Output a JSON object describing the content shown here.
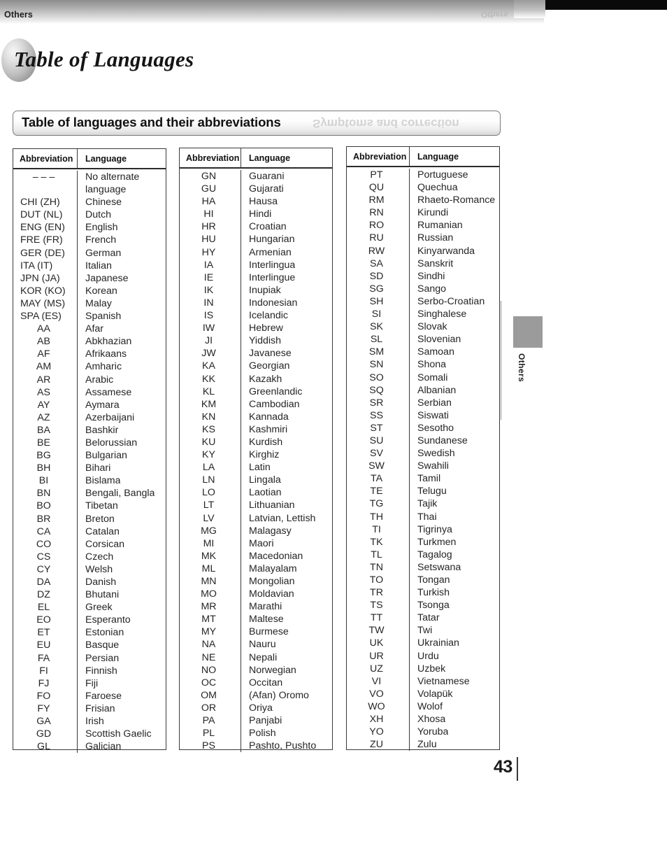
{
  "page": {
    "running_head": "Others",
    "running_head_ghost": "Others",
    "chapter_title": "Table of Languages",
    "section_title": "Table of languages and their abbreviations",
    "section_title_ghost": "Symptoms and correction",
    "side_tab_label": "Others",
    "folio": "43",
    "colors": {
      "ink": "#1a1a1a",
      "table_border": "#3a3a3a",
      "side_tab": "#9b9b9b",
      "header_band": "#a8a8a8"
    }
  },
  "table": {
    "headers": {
      "abbreviation": "Abbreviation",
      "language": "Language"
    },
    "columns": [
      {
        "id": "column-1",
        "rows": [
          {
            "abbr": "– – –",
            "lang": "No alternate\nlanguage",
            "tall": true,
            "abbr_left": false
          },
          {
            "abbr": "CHI (ZH)",
            "lang": "Chinese",
            "abbr_left": true
          },
          {
            "abbr": "DUT (NL)",
            "lang": "Dutch",
            "abbr_left": true
          },
          {
            "abbr": "ENG (EN)",
            "lang": "English",
            "abbr_left": true
          },
          {
            "abbr": "FRE (FR)",
            "lang": "French",
            "abbr_left": true
          },
          {
            "abbr": "GER (DE)",
            "lang": "German",
            "abbr_left": true
          },
          {
            "abbr": "ITA (IT)",
            "lang": "Italian",
            "abbr_left": true
          },
          {
            "abbr": "JPN (JA)",
            "lang": "Japanese",
            "abbr_left": true
          },
          {
            "abbr": "KOR (KO)",
            "lang": "Korean",
            "abbr_left": true
          },
          {
            "abbr": "MAY (MS)",
            "lang": "Malay",
            "abbr_left": true
          },
          {
            "abbr": "SPA (ES)",
            "lang": "Spanish",
            "abbr_left": true
          },
          {
            "abbr": "AA",
            "lang": "Afar"
          },
          {
            "abbr": "AB",
            "lang": "Abkhazian"
          },
          {
            "abbr": "AF",
            "lang": "Afrikaans"
          },
          {
            "abbr": "AM",
            "lang": "Amharic"
          },
          {
            "abbr": "AR",
            "lang": "Arabic"
          },
          {
            "abbr": "AS",
            "lang": "Assamese"
          },
          {
            "abbr": "AY",
            "lang": "Aymara"
          },
          {
            "abbr": "AZ",
            "lang": "Azerbaijani"
          },
          {
            "abbr": "BA",
            "lang": "Bashkir"
          },
          {
            "abbr": "BE",
            "lang": "Belorussian"
          },
          {
            "abbr": "BG",
            "lang": "Bulgarian"
          },
          {
            "abbr": "BH",
            "lang": "Bihari"
          },
          {
            "abbr": "BI",
            "lang": "Bislama"
          },
          {
            "abbr": "BN",
            "lang": "Bengali, Bangla"
          },
          {
            "abbr": "BO",
            "lang": "Tibetan"
          },
          {
            "abbr": "BR",
            "lang": "Breton"
          },
          {
            "abbr": "CA",
            "lang": "Catalan"
          },
          {
            "abbr": "CO",
            "lang": "Corsican"
          },
          {
            "abbr": "CS",
            "lang": "Czech"
          },
          {
            "abbr": "CY",
            "lang": "Welsh"
          },
          {
            "abbr": "DA",
            "lang": "Danish"
          },
          {
            "abbr": "DZ",
            "lang": "Bhutani"
          },
          {
            "abbr": "EL",
            "lang": "Greek"
          },
          {
            "abbr": "EO",
            "lang": "Esperanto"
          },
          {
            "abbr": "ET",
            "lang": "Estonian"
          },
          {
            "abbr": "EU",
            "lang": "Basque"
          },
          {
            "abbr": "FA",
            "lang": "Persian"
          },
          {
            "abbr": "FI",
            "lang": "Finnish"
          },
          {
            "abbr": "FJ",
            "lang": "Fiji"
          },
          {
            "abbr": "FO",
            "lang": "Faroese"
          },
          {
            "abbr": "FY",
            "lang": "Frisian"
          },
          {
            "abbr": "GA",
            "lang": "Irish"
          },
          {
            "abbr": "GD",
            "lang": "Scottish Gaelic"
          },
          {
            "abbr": "GL",
            "lang": "Galician"
          }
        ]
      },
      {
        "id": "column-2",
        "rows": [
          {
            "abbr": "GN",
            "lang": "Guarani"
          },
          {
            "abbr": "GU",
            "lang": "Gujarati"
          },
          {
            "abbr": "HA",
            "lang": "Hausa"
          },
          {
            "abbr": "HI",
            "lang": "Hindi"
          },
          {
            "abbr": "HR",
            "lang": "Croatian"
          },
          {
            "abbr": "HU",
            "lang": "Hungarian"
          },
          {
            "abbr": "HY",
            "lang": "Armenian"
          },
          {
            "abbr": "IA",
            "lang": "Interlingua"
          },
          {
            "abbr": "IE",
            "lang": "Interlingue"
          },
          {
            "abbr": "IK",
            "lang": "Inupiak"
          },
          {
            "abbr": "IN",
            "lang": "Indonesian"
          },
          {
            "abbr": "IS",
            "lang": "Icelandic"
          },
          {
            "abbr": "IW",
            "lang": "Hebrew"
          },
          {
            "abbr": "JI",
            "lang": "Yiddish"
          },
          {
            "abbr": "JW",
            "lang": "Javanese"
          },
          {
            "abbr": "KA",
            "lang": "Georgian"
          },
          {
            "abbr": "KK",
            "lang": "Kazakh"
          },
          {
            "abbr": "KL",
            "lang": "Greenlandic"
          },
          {
            "abbr": "KM",
            "lang": "Cambodian"
          },
          {
            "abbr": "KN",
            "lang": "Kannada"
          },
          {
            "abbr": "KS",
            "lang": "Kashmiri"
          },
          {
            "abbr": "KU",
            "lang": "Kurdish"
          },
          {
            "abbr": "KY",
            "lang": "Kirghiz"
          },
          {
            "abbr": "LA",
            "lang": "Latin"
          },
          {
            "abbr": "LN",
            "lang": "Lingala"
          },
          {
            "abbr": "LO",
            "lang": "Laotian"
          },
          {
            "abbr": "LT",
            "lang": "Lithuanian"
          },
          {
            "abbr": "LV",
            "lang": "Latvian, Lettish"
          },
          {
            "abbr": "MG",
            "lang": "Malagasy"
          },
          {
            "abbr": "MI",
            "lang": "Maori"
          },
          {
            "abbr": "MK",
            "lang": "Macedonian"
          },
          {
            "abbr": "ML",
            "lang": "Malayalam"
          },
          {
            "abbr": "MN",
            "lang": "Mongolian"
          },
          {
            "abbr": "MO",
            "lang": "Moldavian"
          },
          {
            "abbr": "MR",
            "lang": "Marathi"
          },
          {
            "abbr": "MT",
            "lang": "Maltese"
          },
          {
            "abbr": "MY",
            "lang": "Burmese"
          },
          {
            "abbr": "NA",
            "lang": "Nauru"
          },
          {
            "abbr": "NE",
            "lang": "Nepali"
          },
          {
            "abbr": "NO",
            "lang": "Norwegian"
          },
          {
            "abbr": "OC",
            "lang": "Occitan"
          },
          {
            "abbr": "OM",
            "lang": "(Afan) Oromo"
          },
          {
            "abbr": "OR",
            "lang": "Oriya"
          },
          {
            "abbr": "PA",
            "lang": "Panjabi"
          },
          {
            "abbr": "PL",
            "lang": "Polish"
          },
          {
            "abbr": "PS",
            "lang": "Pashto, Pushto"
          }
        ]
      },
      {
        "id": "column-3",
        "rows": [
          {
            "abbr": "PT",
            "lang": "Portuguese"
          },
          {
            "abbr": "QU",
            "lang": "Quechua"
          },
          {
            "abbr": "RM",
            "lang": "Rhaeto-Romance"
          },
          {
            "abbr": "RN",
            "lang": "Kirundi"
          },
          {
            "abbr": "RO",
            "lang": "Rumanian"
          },
          {
            "abbr": "RU",
            "lang": "Russian"
          },
          {
            "abbr": "RW",
            "lang": "Kinyarwanda"
          },
          {
            "abbr": "SA",
            "lang": "Sanskrit"
          },
          {
            "abbr": "SD",
            "lang": "Sindhi"
          },
          {
            "abbr": "SG",
            "lang": "Sango"
          },
          {
            "abbr": "SH",
            "lang": "Serbo-Croatian"
          },
          {
            "abbr": "SI",
            "lang": "Singhalese"
          },
          {
            "abbr": "SK",
            "lang": "Slovak"
          },
          {
            "abbr": "SL",
            "lang": "Slovenian"
          },
          {
            "abbr": "SM",
            "lang": "Samoan"
          },
          {
            "abbr": "SN",
            "lang": "Shona"
          },
          {
            "abbr": "SO",
            "lang": "Somali"
          },
          {
            "abbr": "SQ",
            "lang": "Albanian"
          },
          {
            "abbr": "SR",
            "lang": "Serbian"
          },
          {
            "abbr": "SS",
            "lang": "Siswati"
          },
          {
            "abbr": "ST",
            "lang": "Sesotho"
          },
          {
            "abbr": "SU",
            "lang": "Sundanese"
          },
          {
            "abbr": "SV",
            "lang": "Swedish"
          },
          {
            "abbr": "SW",
            "lang": "Swahili"
          },
          {
            "abbr": "TA",
            "lang": "Tamil"
          },
          {
            "abbr": "TE",
            "lang": "Telugu"
          },
          {
            "abbr": "TG",
            "lang": "Tajik"
          },
          {
            "abbr": "TH",
            "lang": "Thai"
          },
          {
            "abbr": "TI",
            "lang": "Tigrinya"
          },
          {
            "abbr": "TK",
            "lang": "Turkmen"
          },
          {
            "abbr": "TL",
            "lang": "Tagalog"
          },
          {
            "abbr": "TN",
            "lang": "Setswana"
          },
          {
            "abbr": "TO",
            "lang": "Tongan"
          },
          {
            "abbr": "TR",
            "lang": "Turkish"
          },
          {
            "abbr": "TS",
            "lang": "Tsonga"
          },
          {
            "abbr": "TT",
            "lang": "Tatar"
          },
          {
            "abbr": "TW",
            "lang": "Twi"
          },
          {
            "abbr": "UK",
            "lang": "Ukrainian"
          },
          {
            "abbr": "UR",
            "lang": "Urdu"
          },
          {
            "abbr": "UZ",
            "lang": "Uzbek"
          },
          {
            "abbr": "VI",
            "lang": "Vietnamese"
          },
          {
            "abbr": "VO",
            "lang": "Volapük"
          },
          {
            "abbr": "WO",
            "lang": "Wolof"
          },
          {
            "abbr": "XH",
            "lang": "Xhosa"
          },
          {
            "abbr": "YO",
            "lang": "Yoruba"
          },
          {
            "abbr": "ZU",
            "lang": "Zulu"
          }
        ]
      }
    ]
  }
}
